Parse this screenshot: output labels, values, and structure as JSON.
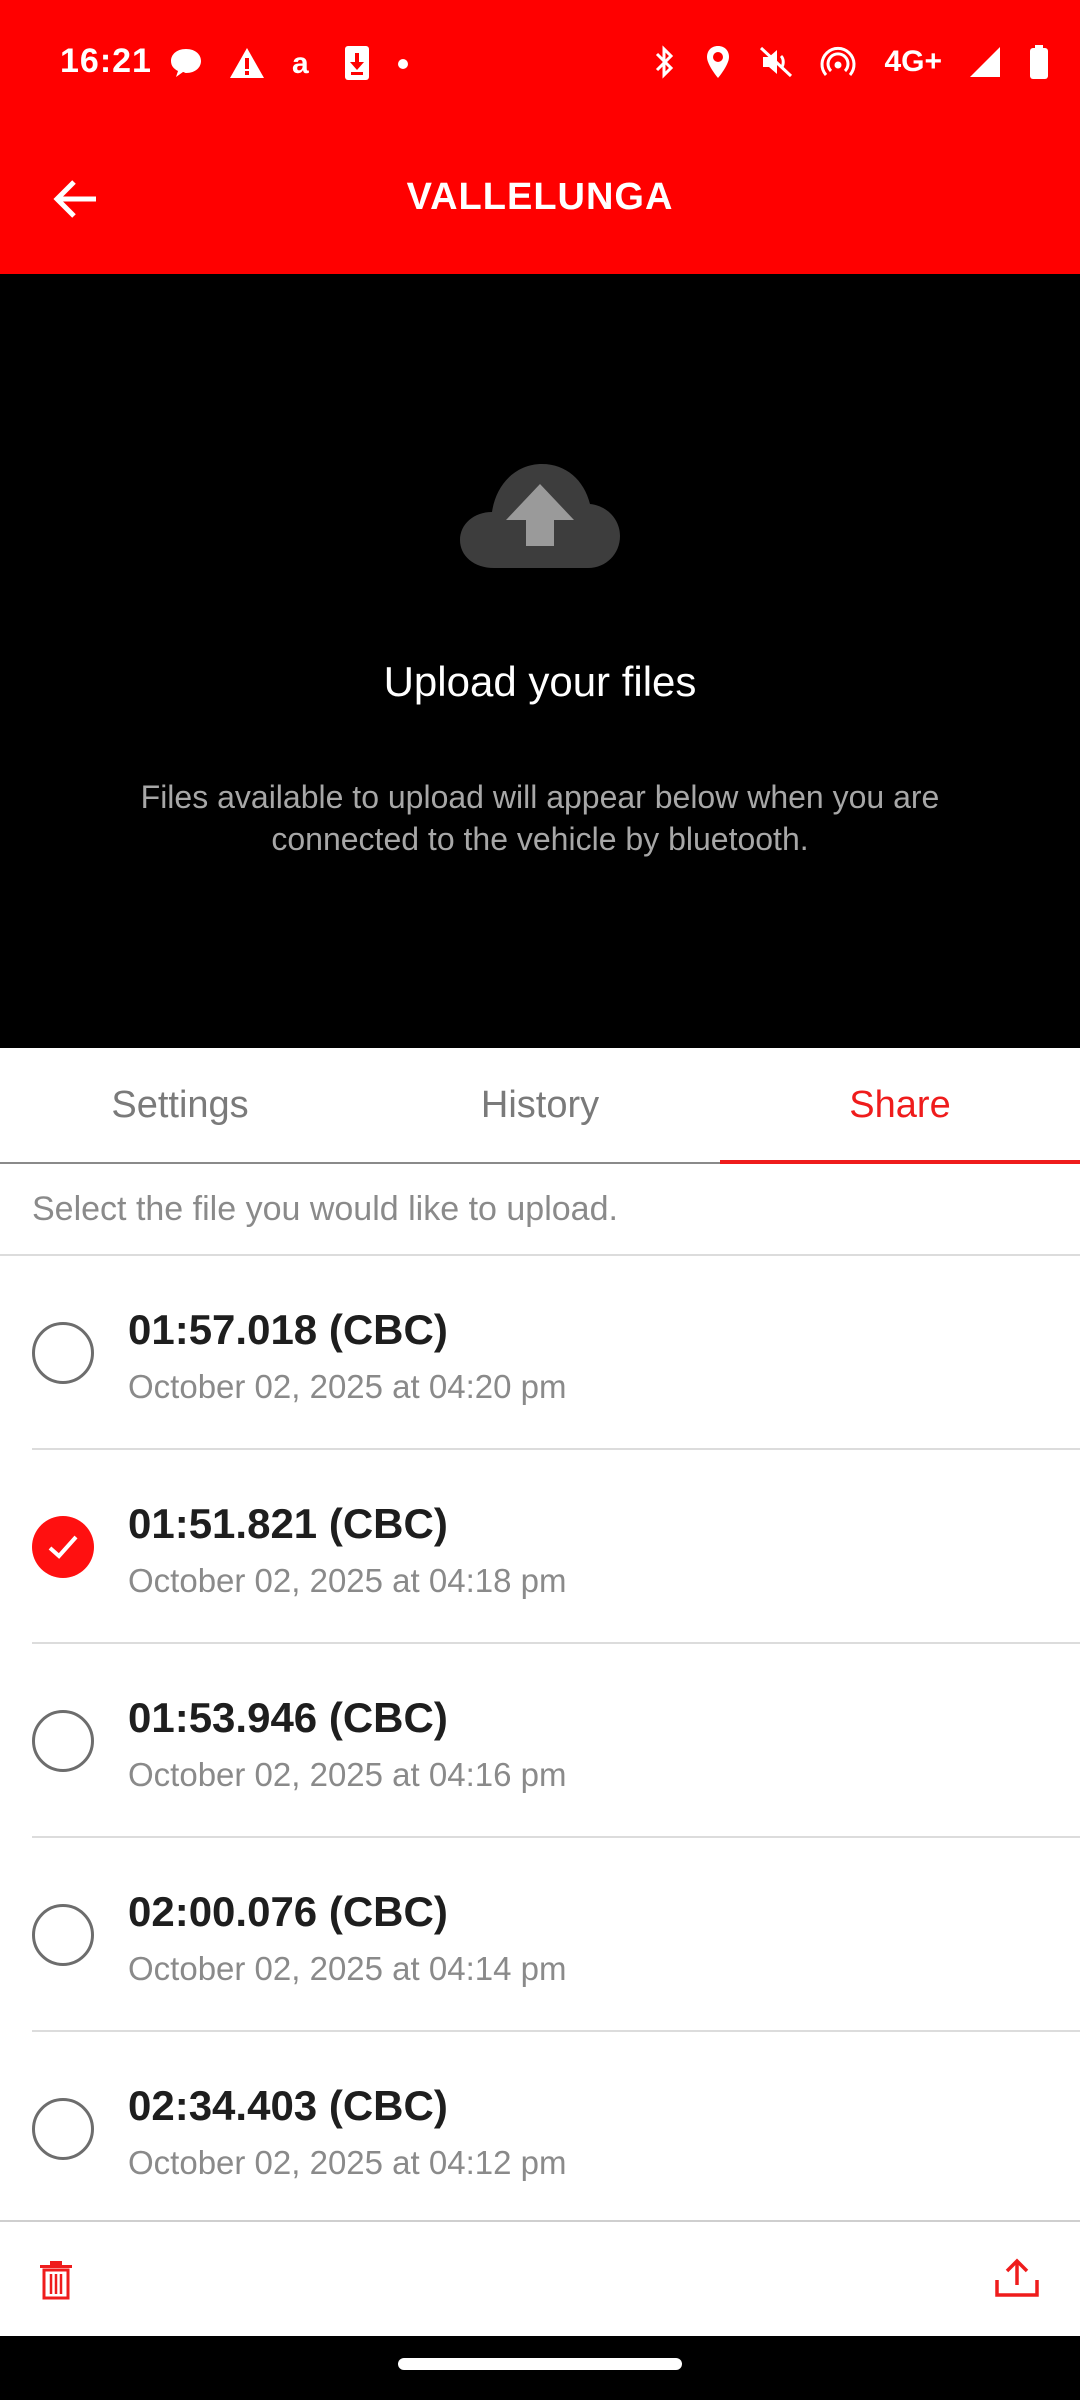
{
  "status_bar": {
    "time": "16:21",
    "left_icons": [
      "chat-bubble-icon",
      "warning-icon",
      "amazon-icon",
      "download-icon",
      "dot-icon"
    ],
    "network": "4G+",
    "right_icons": [
      "bluetooth-icon",
      "location-icon",
      "mute-icon",
      "hotspot-icon",
      "signal-icon",
      "battery-icon"
    ]
  },
  "app_bar": {
    "title": "VALLELUNGA",
    "back_icon": "arrow-left-icon"
  },
  "hero": {
    "icon": "cloud-upload-icon",
    "title": "Upload your files",
    "description": "Files available to upload will appear below when you are connected to the vehicle by bluetooth."
  },
  "tabs": [
    {
      "label": "Settings",
      "active": false
    },
    {
      "label": "History",
      "active": false
    },
    {
      "label": "Share",
      "active": true
    }
  ],
  "hint": "Select the file you would like to upload.",
  "files": [
    {
      "title": "01:57.018 (CBC)",
      "date": "October 02, 2025 at 04:20 pm",
      "selected": false
    },
    {
      "title": "01:51.821 (CBC)",
      "date": "October 02, 2025 at 04:18 pm",
      "selected": true
    },
    {
      "title": "01:53.946 (CBC)",
      "date": "October 02, 2025 at 04:16 pm",
      "selected": false
    },
    {
      "title": "02:00.076 (CBC)",
      "date": "October 02, 2025 at 04:14 pm",
      "selected": false
    },
    {
      "title": "02:34.403 (CBC)",
      "date": "October 02, 2025 at 04:12 pm",
      "selected": false
    }
  ],
  "toolbar": {
    "delete_icon": "trash-icon",
    "share_icon": "upload-share-icon"
  },
  "colors": {
    "brand_red": "#ff0000",
    "accent_red": "#ef1c1c",
    "hero_bg": "#000000"
  }
}
